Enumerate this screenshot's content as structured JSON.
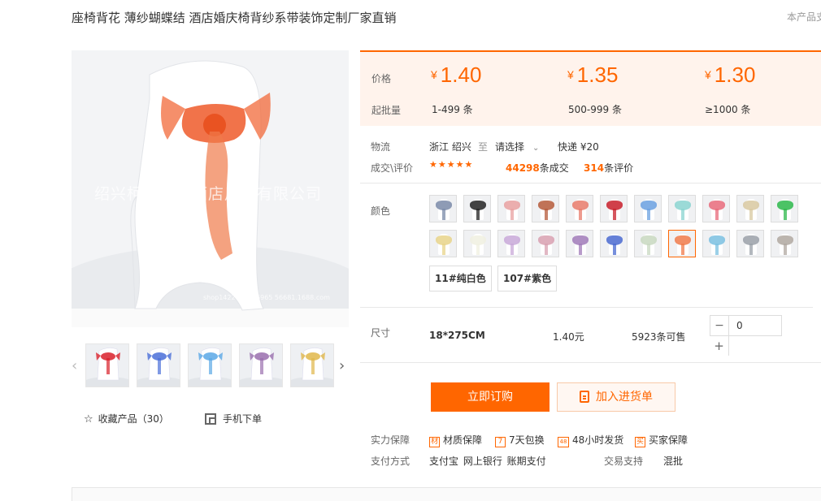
{
  "product": {
    "title": "座椅背花 薄纱蝴蝶结 酒店婚庆椅背纱系带装饰定制厂家直销",
    "title_right": "本产品支持",
    "watermark": "绍兴柯桥鑫诚酒店用品有限公司",
    "shop_mark": "shop1422031486965 56681.1688.com"
  },
  "thumbnails": [
    {
      "name": "thumb-red",
      "color": "#d9202a"
    },
    {
      "name": "thumb-blue",
      "color": "#4a6fd8"
    },
    {
      "name": "thumb-sky",
      "color": "#5aa8e6"
    },
    {
      "name": "thumb-purple",
      "color": "#9a6fae"
    },
    {
      "name": "thumb-gold",
      "color": "#e0b74a"
    }
  ],
  "actions": {
    "favorite": "收藏产品（30）",
    "mobile_order": "手机下单"
  },
  "price": {
    "price_label": "价格",
    "min_label": "起批量",
    "tiers": [
      {
        "currency": "¥",
        "price": "1.40",
        "range": "1-499 条"
      },
      {
        "currency": "¥",
        "price": "1.35",
        "range": "500-999 条"
      },
      {
        "currency": "¥",
        "price": "1.30",
        "range": "≥1000 条"
      }
    ],
    "accent": "#ff6600"
  },
  "logistics": {
    "label": "物流",
    "from": "浙江 绍兴",
    "to": "至",
    "select": "请选择",
    "shipping": "快递 ¥20"
  },
  "deals": {
    "label": "成交\\评价",
    "stars": "★★★★★",
    "count": "44298",
    "count_suffix": "条成交",
    "reviews": "314",
    "reviews_suffix": "条评价"
  },
  "colors": {
    "label": "颜色",
    "swatches": [
      "#7a8aa8",
      "#222222",
      "#e8a0a0",
      "#b55a3a",
      "#e87a6a",
      "#c81f2a",
      "#6aa0e0",
      "#8ad4d0",
      "#e86a7a",
      "#d8c8a0",
      "#2cb84a",
      "#e8d48a",
      "#f0f0e0",
      "#c8a8d8",
      "#d8a0b0",
      "#a07ab8",
      "#4a6ad0",
      "#c8d8c0",
      "#f07a4a",
      "#7ac0e0",
      "#9aa0a8",
      "#b0a8a0"
    ],
    "text_options": [
      "11#纯白色",
      "107#紫色"
    ]
  },
  "size": {
    "label": "尺寸",
    "value": "18*275CM",
    "unit_price": "1.40元",
    "stock": "5923条可售",
    "quantity": "0",
    "minus": "−",
    "plus": "+"
  },
  "buttons": {
    "buy_now": "立即订购",
    "add_to_cart": "加入进货单"
  },
  "guarantees": {
    "label": "实力保障",
    "items": [
      {
        "icon": "材",
        "text": "材质保障"
      },
      {
        "icon": "7",
        "text": "7天包换"
      },
      {
        "icon": "48",
        "text": "48小时发货"
      },
      {
        "icon": "买",
        "text": "买家保障"
      }
    ]
  },
  "payment": {
    "label": "支付方式",
    "methods": "支付宝  网上银行  账期支付",
    "trade_label": "交易支持",
    "trade_value": "混批"
  }
}
